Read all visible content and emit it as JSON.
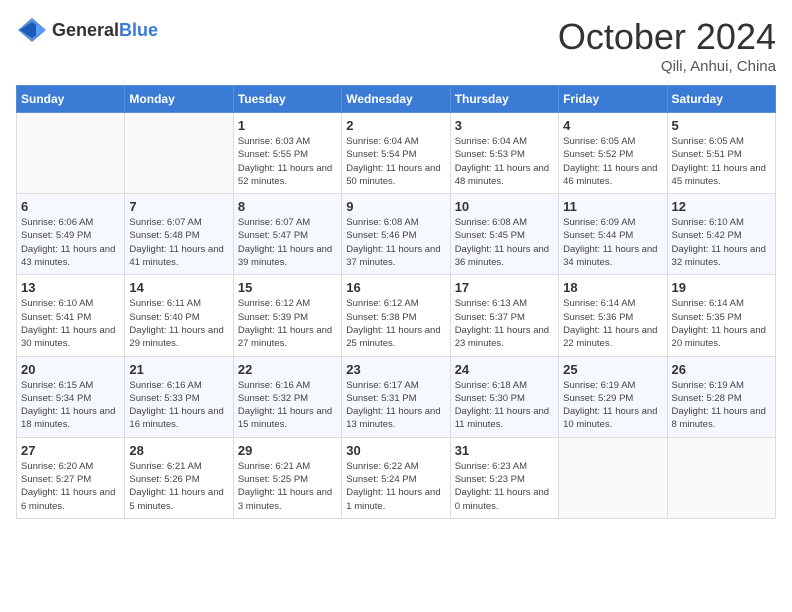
{
  "header": {
    "logo_general": "General",
    "logo_blue": "Blue",
    "month": "October 2024",
    "location": "Qili, Anhui, China"
  },
  "weekdays": [
    "Sunday",
    "Monday",
    "Tuesday",
    "Wednesday",
    "Thursday",
    "Friday",
    "Saturday"
  ],
  "weeks": [
    [
      {
        "day": "",
        "info": ""
      },
      {
        "day": "",
        "info": ""
      },
      {
        "day": "1",
        "info": "Sunrise: 6:03 AM\nSunset: 5:55 PM\nDaylight: 11 hours and 52 minutes."
      },
      {
        "day": "2",
        "info": "Sunrise: 6:04 AM\nSunset: 5:54 PM\nDaylight: 11 hours and 50 minutes."
      },
      {
        "day": "3",
        "info": "Sunrise: 6:04 AM\nSunset: 5:53 PM\nDaylight: 11 hours and 48 minutes."
      },
      {
        "day": "4",
        "info": "Sunrise: 6:05 AM\nSunset: 5:52 PM\nDaylight: 11 hours and 46 minutes."
      },
      {
        "day": "5",
        "info": "Sunrise: 6:05 AM\nSunset: 5:51 PM\nDaylight: 11 hours and 45 minutes."
      }
    ],
    [
      {
        "day": "6",
        "info": "Sunrise: 6:06 AM\nSunset: 5:49 PM\nDaylight: 11 hours and 43 minutes."
      },
      {
        "day": "7",
        "info": "Sunrise: 6:07 AM\nSunset: 5:48 PM\nDaylight: 11 hours and 41 minutes."
      },
      {
        "day": "8",
        "info": "Sunrise: 6:07 AM\nSunset: 5:47 PM\nDaylight: 11 hours and 39 minutes."
      },
      {
        "day": "9",
        "info": "Sunrise: 6:08 AM\nSunset: 5:46 PM\nDaylight: 11 hours and 37 minutes."
      },
      {
        "day": "10",
        "info": "Sunrise: 6:08 AM\nSunset: 5:45 PM\nDaylight: 11 hours and 36 minutes."
      },
      {
        "day": "11",
        "info": "Sunrise: 6:09 AM\nSunset: 5:44 PM\nDaylight: 11 hours and 34 minutes."
      },
      {
        "day": "12",
        "info": "Sunrise: 6:10 AM\nSunset: 5:42 PM\nDaylight: 11 hours and 32 minutes."
      }
    ],
    [
      {
        "day": "13",
        "info": "Sunrise: 6:10 AM\nSunset: 5:41 PM\nDaylight: 11 hours and 30 minutes."
      },
      {
        "day": "14",
        "info": "Sunrise: 6:11 AM\nSunset: 5:40 PM\nDaylight: 11 hours and 29 minutes."
      },
      {
        "day": "15",
        "info": "Sunrise: 6:12 AM\nSunset: 5:39 PM\nDaylight: 11 hours and 27 minutes."
      },
      {
        "day": "16",
        "info": "Sunrise: 6:12 AM\nSunset: 5:38 PM\nDaylight: 11 hours and 25 minutes."
      },
      {
        "day": "17",
        "info": "Sunrise: 6:13 AM\nSunset: 5:37 PM\nDaylight: 11 hours and 23 minutes."
      },
      {
        "day": "18",
        "info": "Sunrise: 6:14 AM\nSunset: 5:36 PM\nDaylight: 11 hours and 22 minutes."
      },
      {
        "day": "19",
        "info": "Sunrise: 6:14 AM\nSunset: 5:35 PM\nDaylight: 11 hours and 20 minutes."
      }
    ],
    [
      {
        "day": "20",
        "info": "Sunrise: 6:15 AM\nSunset: 5:34 PM\nDaylight: 11 hours and 18 minutes."
      },
      {
        "day": "21",
        "info": "Sunrise: 6:16 AM\nSunset: 5:33 PM\nDaylight: 11 hours and 16 minutes."
      },
      {
        "day": "22",
        "info": "Sunrise: 6:16 AM\nSunset: 5:32 PM\nDaylight: 11 hours and 15 minutes."
      },
      {
        "day": "23",
        "info": "Sunrise: 6:17 AM\nSunset: 5:31 PM\nDaylight: 11 hours and 13 minutes."
      },
      {
        "day": "24",
        "info": "Sunrise: 6:18 AM\nSunset: 5:30 PM\nDaylight: 11 hours and 11 minutes."
      },
      {
        "day": "25",
        "info": "Sunrise: 6:19 AM\nSunset: 5:29 PM\nDaylight: 11 hours and 10 minutes."
      },
      {
        "day": "26",
        "info": "Sunrise: 6:19 AM\nSunset: 5:28 PM\nDaylight: 11 hours and 8 minutes."
      }
    ],
    [
      {
        "day": "27",
        "info": "Sunrise: 6:20 AM\nSunset: 5:27 PM\nDaylight: 11 hours and 6 minutes."
      },
      {
        "day": "28",
        "info": "Sunrise: 6:21 AM\nSunset: 5:26 PM\nDaylight: 11 hours and 5 minutes."
      },
      {
        "day": "29",
        "info": "Sunrise: 6:21 AM\nSunset: 5:25 PM\nDaylight: 11 hours and 3 minutes."
      },
      {
        "day": "30",
        "info": "Sunrise: 6:22 AM\nSunset: 5:24 PM\nDaylight: 11 hours and 1 minute."
      },
      {
        "day": "31",
        "info": "Sunrise: 6:23 AM\nSunset: 5:23 PM\nDaylight: 11 hours and 0 minutes."
      },
      {
        "day": "",
        "info": ""
      },
      {
        "day": "",
        "info": ""
      }
    ]
  ]
}
